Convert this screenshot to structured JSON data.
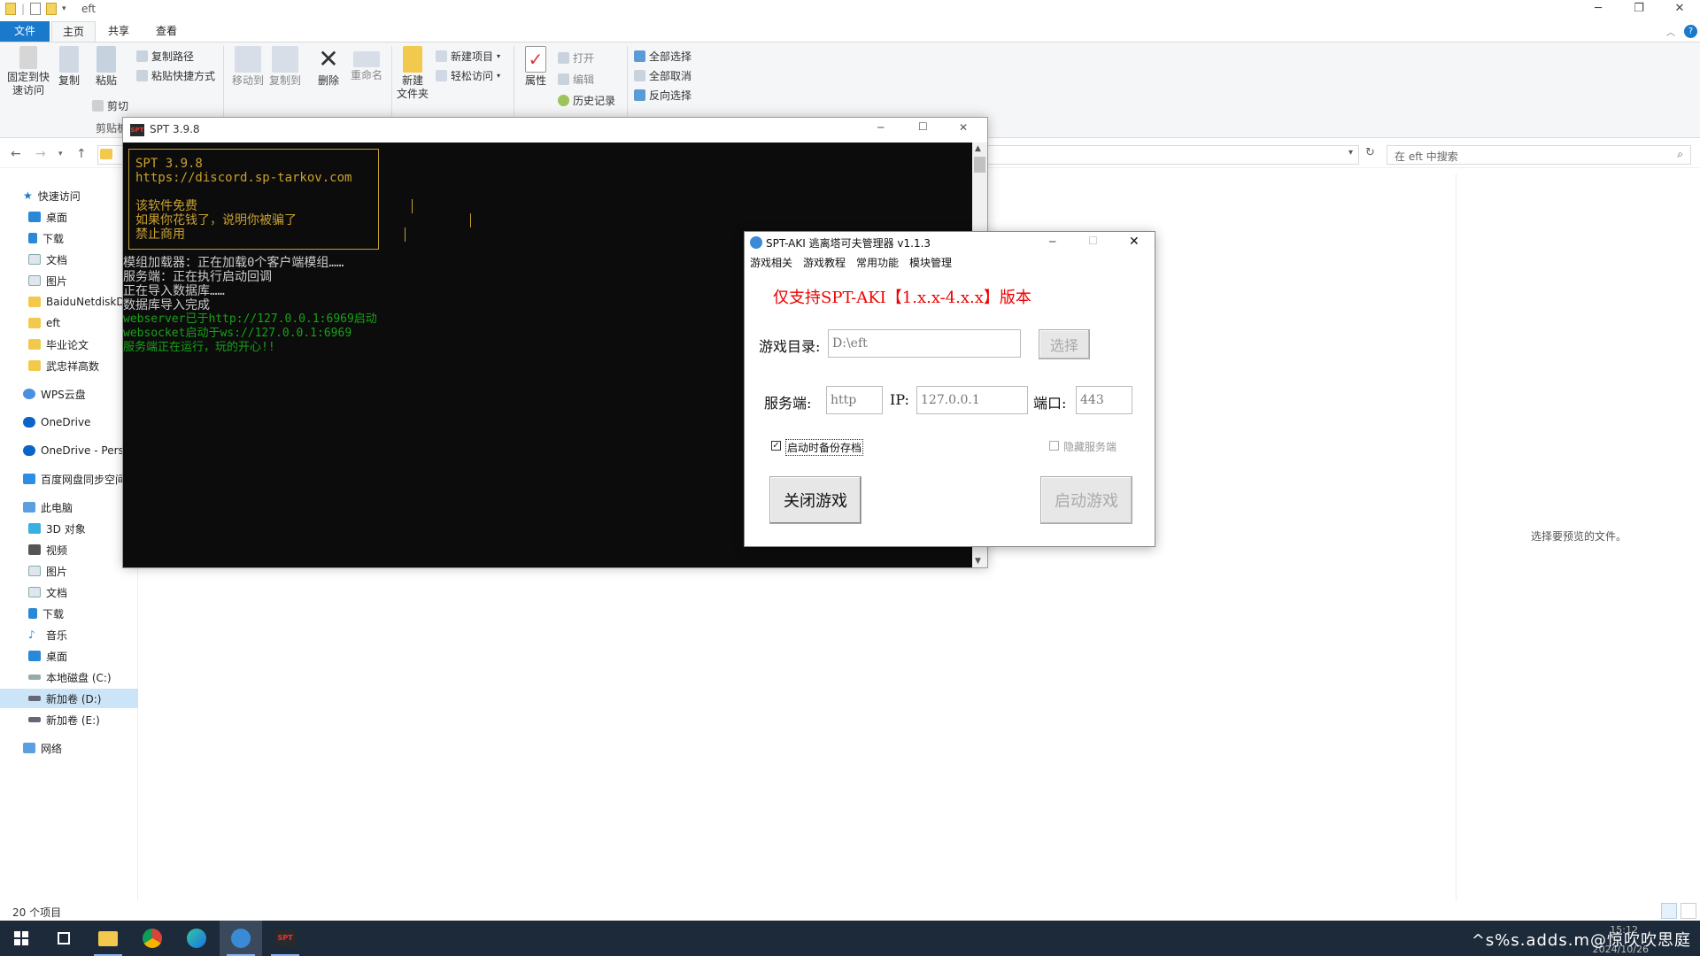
{
  "explorer": {
    "title": "eft",
    "tabs": [
      "文件",
      "主页",
      "共享",
      "查看"
    ],
    "ribbon": {
      "pin_label": "固定到快\n速访问",
      "copy_label": "复制",
      "paste_label": "粘贴",
      "copy_path_label": "复制路径",
      "paste_shortcut_label": "粘贴快捷方式",
      "cut_label": "剪切",
      "clipboard_group": "剪贴板",
      "move_to_label": "移动到",
      "copy_to_label": "复制到",
      "delete_label": "删除",
      "rename_label": "重命名",
      "new_folder_label": "新建\n文件夹",
      "new_item_label": "新建项目",
      "easy_access_label": "轻松访问",
      "properties_label": "属性",
      "open_label": "打开",
      "edit_label": "编辑",
      "history_label": "历史记录",
      "select_all_label": "全部选择",
      "select_none_label": "全部取消",
      "invert_selection_label": "反向选择"
    },
    "search_placeholder": "在 eft 中搜索",
    "nav": {
      "quick_access": "快速访问",
      "quick_items": [
        "桌面",
        "下载",
        "文档",
        "图片",
        "BaiduNetdiskDownload",
        "eft",
        "毕业论文",
        "武忠祥高数"
      ],
      "wps": "WPS云盘",
      "onedrive": "OneDrive",
      "onedrive_personal": "OneDrive - Personal",
      "baidu_sync": "百度网盘同步空间",
      "this_pc": "此电脑",
      "pc_items": [
        "3D 对象",
        "视频",
        "图片",
        "文档",
        "下载",
        "音乐",
        "桌面",
        "本地磁盘 (C:)",
        "新加卷 (D:)",
        "新加卷 (E:)"
      ],
      "network": "网络"
    },
    "preview_text": "选择要预览的文件。",
    "status_count": "20 个项目"
  },
  "spt_console": {
    "title": "SPT 3.9.8",
    "badge": "SPT",
    "banner_lines": [
      "SPT 3.9.8",
      "https://discord.sp-tarkov.com",
      "",
      "该软件免费",
      "如果你花钱了，说明你被骗了",
      "禁止商用"
    ],
    "white_lines": [
      "模组加载器：正在加载0个客户端模组……",
      "服务端：正在执行启动回调",
      "正在导入数据库……",
      "数据库导入完成"
    ],
    "green_lines": [
      "webserver已于http://127.0.0.1:6969启动",
      "websocket启动于ws://127.0.0.1:6969",
      "服务端正在运行，玩的开心!!"
    ]
  },
  "aki_launcher": {
    "title": "SPT-AKI 逃离塔可夫管理器 v1.1.3",
    "menu": [
      "游戏相关",
      "游戏教程",
      "常用功能",
      "模块管理"
    ],
    "notice": "仅支持SPT-AKI【1.x.x-4.x.x】版本",
    "game_dir_label": "游戏目录:",
    "game_dir_value": "D:\\eft",
    "choose_button": "选择",
    "server_label": "服务端:",
    "protocol_value": "http",
    "ip_label": "IP:",
    "ip_value": "127.0.0.1",
    "port_label": "端口:",
    "port_value": "443",
    "backup_checkbox": "启动时备份存档",
    "hide_server_checkbox": "隐藏服务端",
    "close_game_button": "关闭游戏",
    "start_game_button": "启动游戏"
  },
  "taskbar": {
    "tray_text": "^s%s.adds.m@惊吹吹思庭",
    "time": "15:12",
    "date": "2024/10/26",
    "spt_label": "SPT"
  },
  "colors": {
    "console_bg": "#0c0c0c",
    "console_yellow": "#c8a02e",
    "console_green": "#16a316",
    "notice_red": "#e00000",
    "file_tab": "#1979ca",
    "taskbar": "#1c2a3a"
  }
}
